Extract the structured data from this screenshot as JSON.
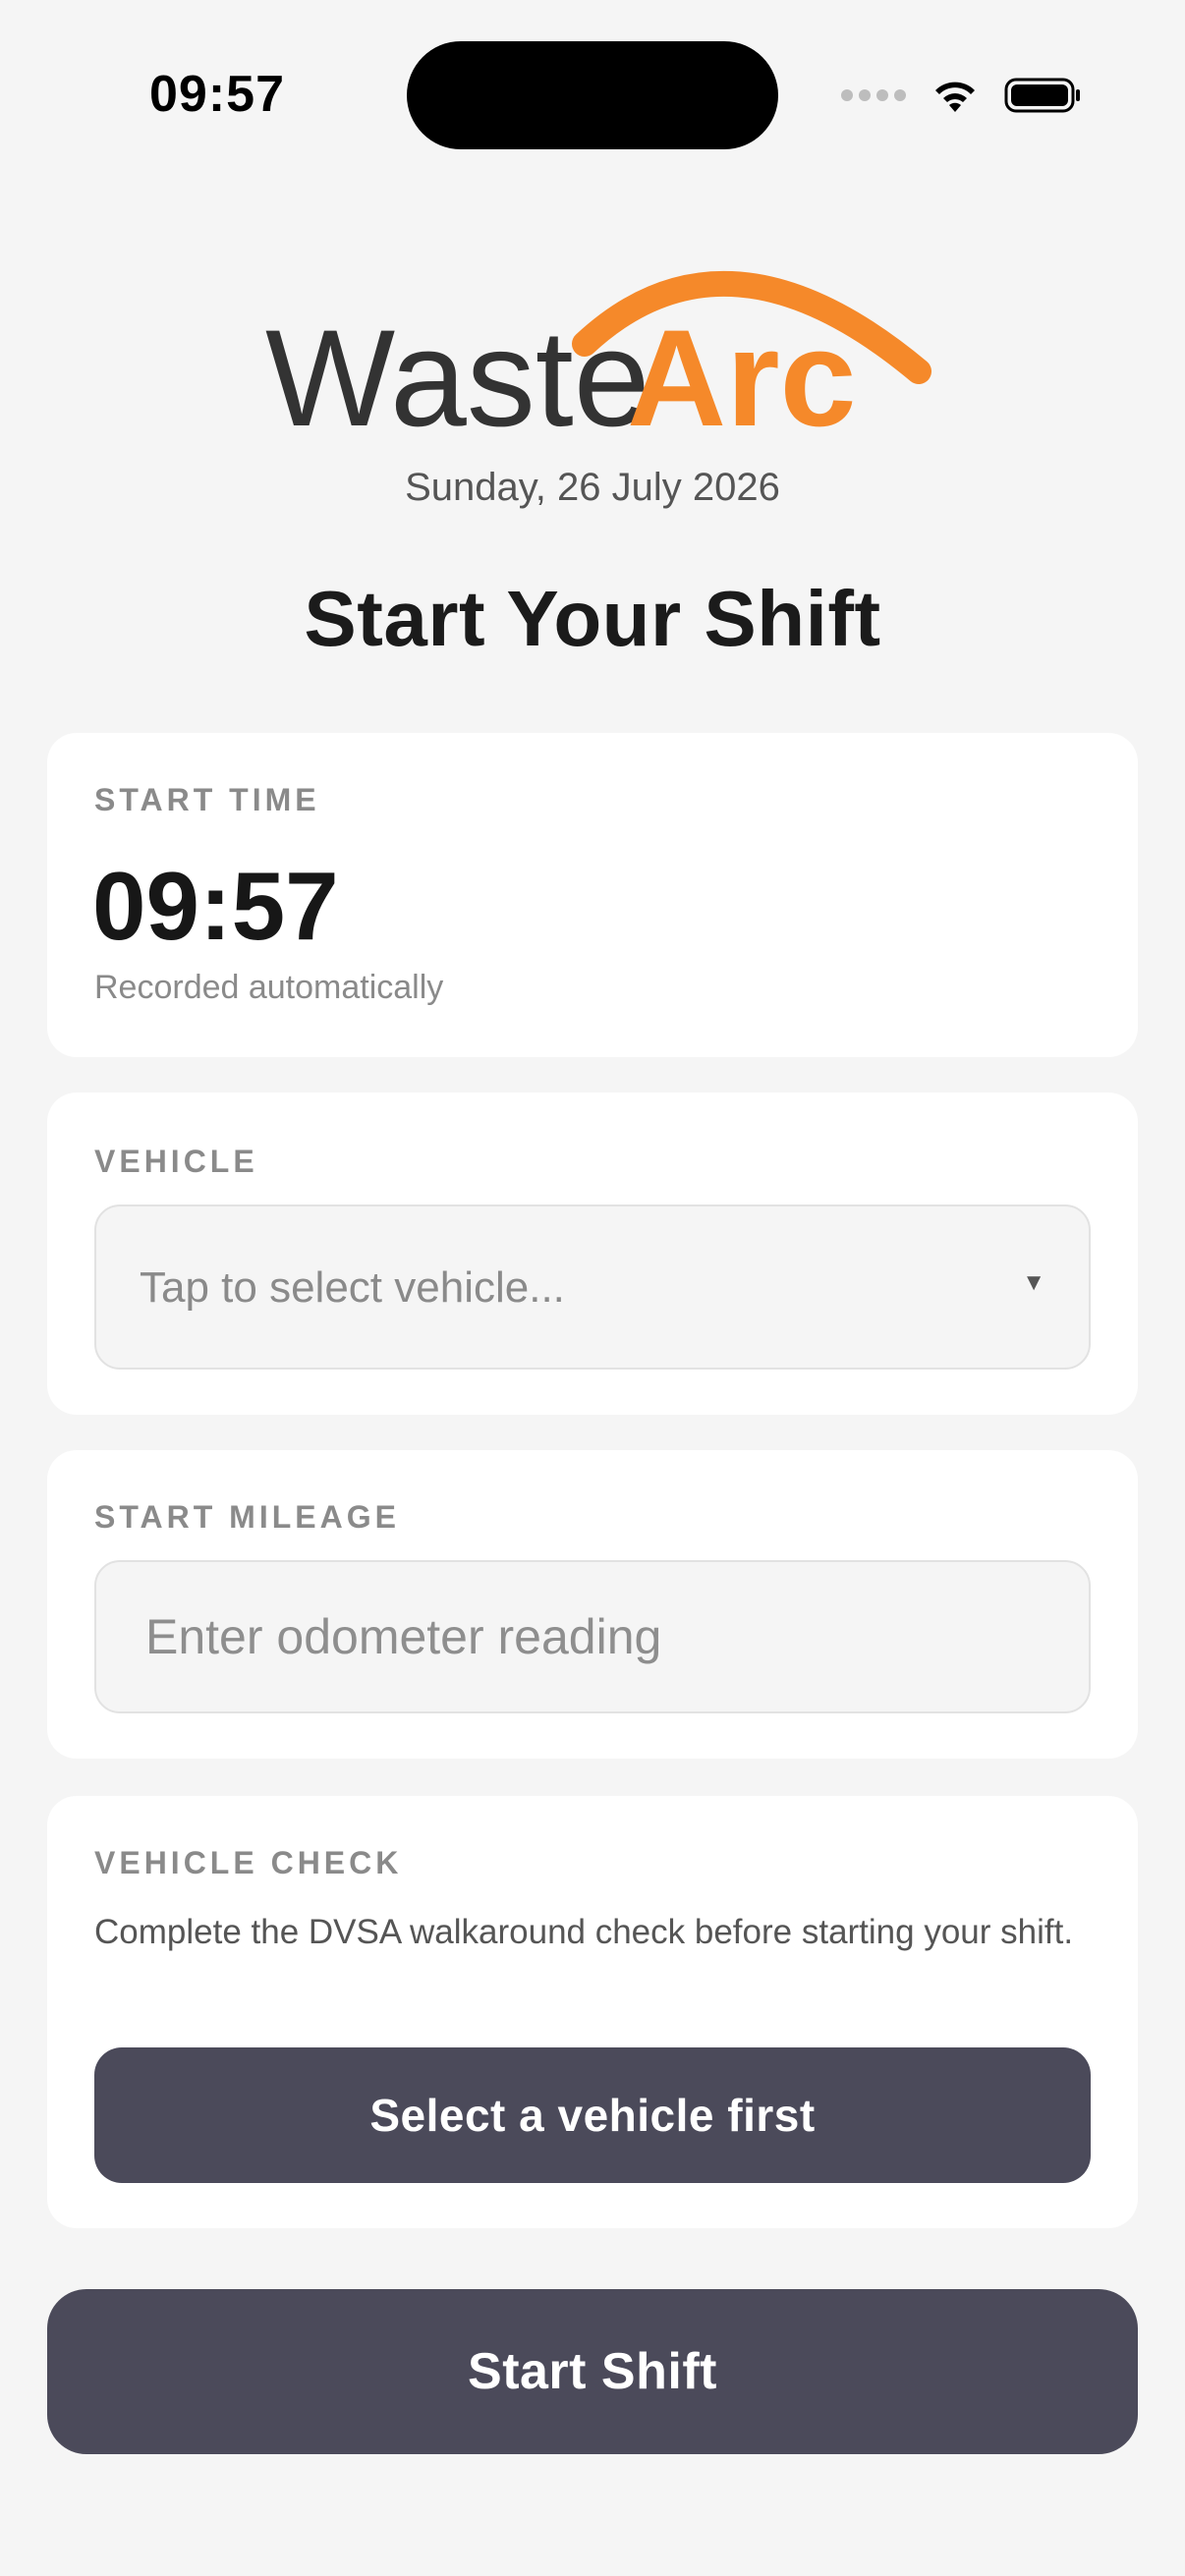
{
  "status_bar": {
    "time": "09:57",
    "icons": [
      "signal-icon",
      "wifi-icon",
      "battery-icon"
    ]
  },
  "logo": {
    "part1": "Waste",
    "part2": "Arc",
    "text_color": "#333333",
    "accent_color": "#f5892a"
  },
  "date": "Sunday, 26 July 2026",
  "title": "Start Your Shift",
  "start_time": {
    "label": "START TIME",
    "value": "09:57",
    "hint": "Recorded automatically"
  },
  "vehicle": {
    "label": "VEHICLE",
    "placeholder": "Tap to select vehicle...",
    "caret": "▼"
  },
  "mileage": {
    "label": "START MILEAGE",
    "placeholder": "Enter odometer reading",
    "value": ""
  },
  "vehicle_check": {
    "label": "VEHICLE CHECK",
    "description": "Complete the DVSA walkaround check before starting your shift.",
    "button_label": "Select a vehicle first"
  },
  "start_shift_label": "Start Shift",
  "colors": {
    "background": "#f5f5f5",
    "card": "#ffffff",
    "button": "#4b4a5a",
    "accent": "#f5892a"
  }
}
